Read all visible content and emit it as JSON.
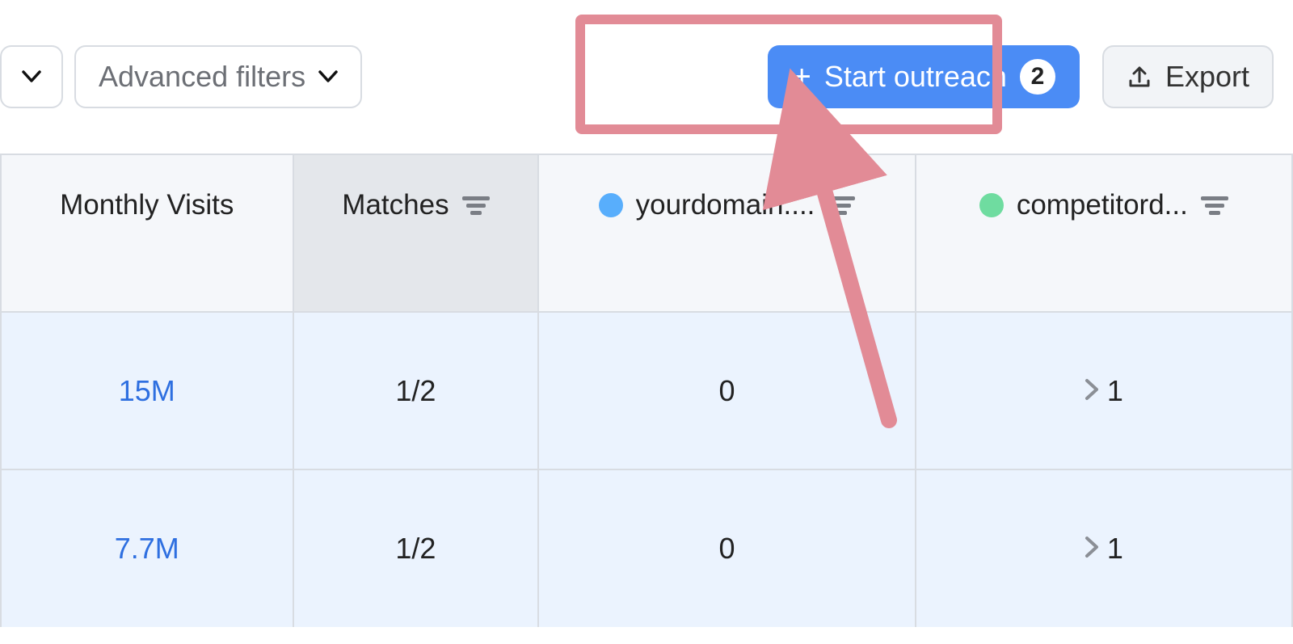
{
  "toolbar": {
    "advanced_filters_label": "Advanced filters",
    "start_outreach_label": "Start outreach",
    "start_outreach_count": "2",
    "export_label": "Export"
  },
  "columns": {
    "monthly_visits": "Monthly Visits",
    "matches": "Matches",
    "yourdomain": "yourdomain....",
    "competitor": "competitord..."
  },
  "rows": [
    {
      "visits": "15M",
      "matches": "1/2",
      "yourdomain": "0",
      "competitor": "1"
    },
    {
      "visits": "7.7M",
      "matches": "1/2",
      "yourdomain": "0",
      "competitor": "1"
    }
  ],
  "colors": {
    "highlight": "#e28b96",
    "primary": "#4b8cf5",
    "dot_blue": "#58aefc",
    "dot_green": "#6fdca0"
  }
}
